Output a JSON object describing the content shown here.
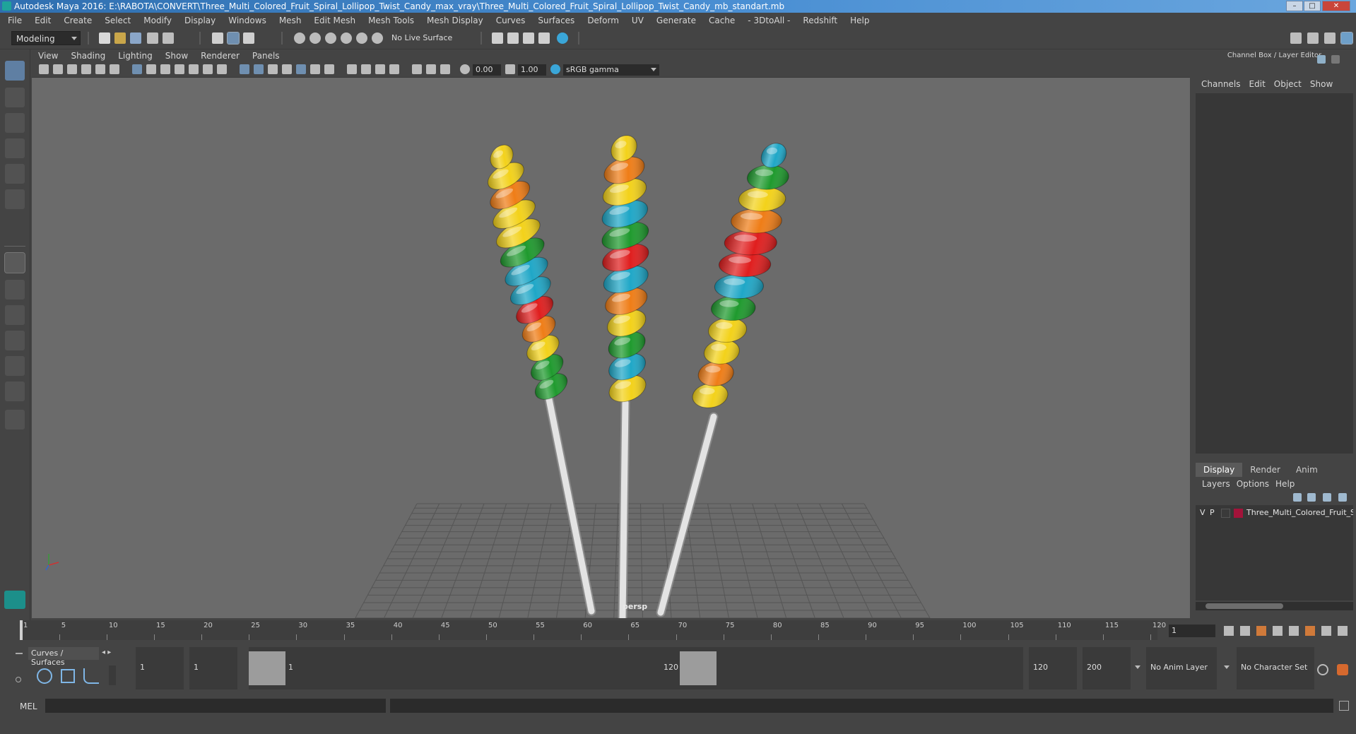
{
  "window": {
    "title": "Autodesk Maya 2016: E:\\RABOTA\\CONVERT\\Three_Multi_Colored_Fruit_Spiral_Lollipop_Twist_Candy_max_vray\\Three_Multi_Colored_Fruit_Spiral_Lollipop_Twist_Candy_mb_standart.mb",
    "minimize": "–",
    "maximize": "□",
    "close": "✕"
  },
  "menu": [
    "File",
    "Edit",
    "Create",
    "Select",
    "Modify",
    "Display",
    "Windows",
    "Mesh",
    "Edit Mesh",
    "Mesh Tools",
    "Mesh Display",
    "Curves",
    "Surfaces",
    "Deform",
    "UV",
    "Generate",
    "Cache",
    "- 3DtoAll -",
    "Redshift",
    "Help"
  ],
  "shelf": {
    "mode": "Modeling",
    "live_surface": "No Live Surface"
  },
  "viewport": {
    "menu": [
      "View",
      "Shading",
      "Lighting",
      "Show",
      "Renderer",
      "Panels"
    ],
    "exposure": "0.00",
    "gamma": "1.00",
    "color_space": "sRGB gamma",
    "camera_label": "persp"
  },
  "colors": {
    "lollipop_stripes": [
      "#f3d21a",
      "#ef7d17",
      "#1f9a2e",
      "#1fa7c7",
      "#e01e1e"
    ],
    "stick": "#e3e3e3",
    "layer_swatch": "#a3133a"
  },
  "channel_box": {
    "header": "Channel Box / Layer Editor",
    "menu": [
      "Channels",
      "Edit",
      "Object",
      "Show"
    ]
  },
  "layer_editor": {
    "tabs": [
      "Display",
      "Render",
      "Anim"
    ],
    "active_tab": "Display",
    "menu": [
      "Layers",
      "Options",
      "Help"
    ],
    "layers": [
      {
        "v": "V",
        "p": "P",
        "name": "Three_Multi_Colored_Fruit_Sp"
      }
    ]
  },
  "timeline": {
    "ticks": [
      "1",
      "5",
      "10",
      "15",
      "20",
      "25",
      "30",
      "35",
      "40",
      "45",
      "50",
      "55",
      "60",
      "65",
      "70",
      "75",
      "80",
      "85",
      "90",
      "95",
      "100",
      "105",
      "110",
      "115",
      "120"
    ],
    "current_frame": "1"
  },
  "range": {
    "shelf_tab": "Curves / Surfaces",
    "start": "1",
    "playback_start": "1",
    "slider_start": "1",
    "slider_end": "120",
    "playback_end": "120",
    "end": "200",
    "anim_layer": "No Anim Layer",
    "character_set": "No Character Set"
  },
  "command_line": {
    "label": "MEL"
  }
}
